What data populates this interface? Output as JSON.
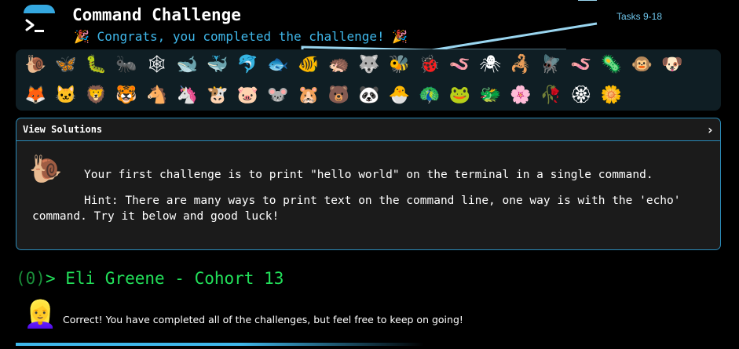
{
  "header": {
    "title": "Command Challenge",
    "congrats": "🎉 Congrats, you completed the challenge! 🎉",
    "tasks_annotation": "Tasks 9-18"
  },
  "icons": {
    "row1": [
      {
        "name": "snail-icon",
        "glyph": "🐌"
      },
      {
        "name": "butterfly-icon",
        "glyph": "🦋"
      },
      {
        "name": "caterpillar-icon",
        "glyph": "🐛"
      },
      {
        "name": "ant-icon",
        "glyph": "🐜"
      },
      {
        "name": "spider-web-icon",
        "glyph": "🕸"
      },
      {
        "name": "whale-icon",
        "glyph": "🐋"
      },
      {
        "name": "whale-spouting-icon",
        "glyph": "🐳"
      },
      {
        "name": "dolphin-icon",
        "glyph": "🐬"
      },
      {
        "name": "fish-icon",
        "glyph": "🐟"
      },
      {
        "name": "tropical-fish-icon",
        "glyph": "🐠"
      },
      {
        "name": "hedgehog-icon",
        "glyph": "🦔"
      },
      {
        "name": "wolf-icon",
        "glyph": "🐺"
      },
      {
        "name": "bee-icon",
        "glyph": "🐝"
      },
      {
        "name": "ladybug-icon",
        "glyph": "🐞"
      },
      {
        "name": "worm-icon",
        "glyph": "🪱"
      },
      {
        "name": "spider-icon",
        "glyph": "🕷"
      },
      {
        "name": "scorpion-icon",
        "glyph": "🦂"
      },
      {
        "name": "fly-icon",
        "glyph": "🪰"
      },
      {
        "name": "pink-worm-icon",
        "glyph": "🪱"
      },
      {
        "name": "microbe-icon",
        "glyph": "🦠"
      },
      {
        "name": "monkey-icon",
        "glyph": "🐵"
      },
      {
        "name": "dog-icon",
        "glyph": "🐶"
      }
    ],
    "row2": [
      {
        "name": "fox-icon",
        "glyph": "🦊"
      },
      {
        "name": "cat-icon",
        "glyph": "🐱"
      },
      {
        "name": "lion-icon",
        "glyph": "🦁"
      },
      {
        "name": "tiger-icon",
        "glyph": "🐯"
      },
      {
        "name": "horse-icon",
        "glyph": "🐴"
      },
      {
        "name": "unicorn-icon",
        "glyph": "🦄"
      },
      {
        "name": "cow-icon",
        "glyph": "🐮"
      },
      {
        "name": "pig-icon",
        "glyph": "🐷"
      },
      {
        "name": "mouse-icon",
        "glyph": "🐭"
      },
      {
        "name": "hamster-icon",
        "glyph": "🐹"
      },
      {
        "name": "bear-icon",
        "glyph": "🐻"
      },
      {
        "name": "panda-icon",
        "glyph": "🐼"
      },
      {
        "name": "hatching-chick-icon",
        "glyph": "🐣"
      },
      {
        "name": "peacock-icon",
        "glyph": "🦚"
      },
      {
        "name": "frog-icon",
        "glyph": "🐸"
      },
      {
        "name": "dragon-icon",
        "glyph": "🐲"
      },
      {
        "name": "cherry-blossom-icon",
        "glyph": "🌸"
      },
      {
        "name": "rose-icon",
        "glyph": "🥀"
      },
      {
        "name": "rosette-icon",
        "glyph": "🏵"
      },
      {
        "name": "blossom-icon",
        "glyph": "🌼"
      }
    ]
  },
  "solutions": {
    "label": "View Solutions",
    "chevron": "›",
    "challenge_icon": "🐌",
    "challenge_text": "Your first challenge is to print \"hello world\" on the terminal in a single command.",
    "hint": "Hint: There are many ways to print text on the command line, one way is with the 'echo' command. Try it below and good luck!"
  },
  "prompt": {
    "counter": "(0)",
    "arrow": ">",
    "user": " Eli Greene - Cohort 13"
  },
  "status": {
    "avatar": "👱‍♀️",
    "message": "Correct! You have completed all of the challenges, but feel free to keep on going!"
  },
  "colors": {
    "accent": "#3fb7ea",
    "prompt_green": "#22e05a",
    "panel_border": "#2b8ab8",
    "icon_bar_bg": "#0f1e24"
  }
}
